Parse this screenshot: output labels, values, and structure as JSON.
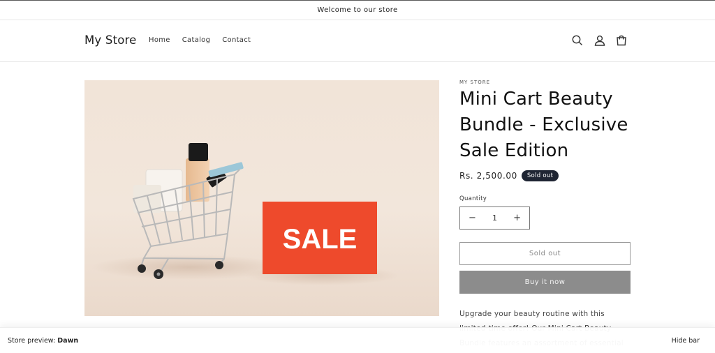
{
  "announcement": {
    "text": "Welcome to our store"
  },
  "header": {
    "logo": "My Store",
    "nav": [
      "Home",
      "Catalog",
      "Contact"
    ],
    "icons": [
      "search-icon",
      "account-icon",
      "cart-icon"
    ]
  },
  "product": {
    "vendor": "MY STORE",
    "title": "Mini Cart Beauty Bundle - Exclusive Sale Edition",
    "price": "Rs. 2,500.00",
    "badge": "Sold out",
    "quantity_label": "Quantity",
    "quantity": "1",
    "minus": "−",
    "plus": "+",
    "sold_out_button": "Sold out",
    "buy_now_button": "Buy it now",
    "description": "Upgrade your beauty routine with this limited-time offer! Our Mini Cart Beauty Bundle features an assortment of essential skincare and beauty",
    "image": {
      "sign_text": "SALE"
    }
  },
  "preview_bar": {
    "label": "Store preview:",
    "theme": "Dawn",
    "hide": "Hide bar"
  },
  "colors": {
    "sale_sign": "#ee4a2c",
    "badge": "#1f2533",
    "buy_button": "#8c8c8c"
  }
}
